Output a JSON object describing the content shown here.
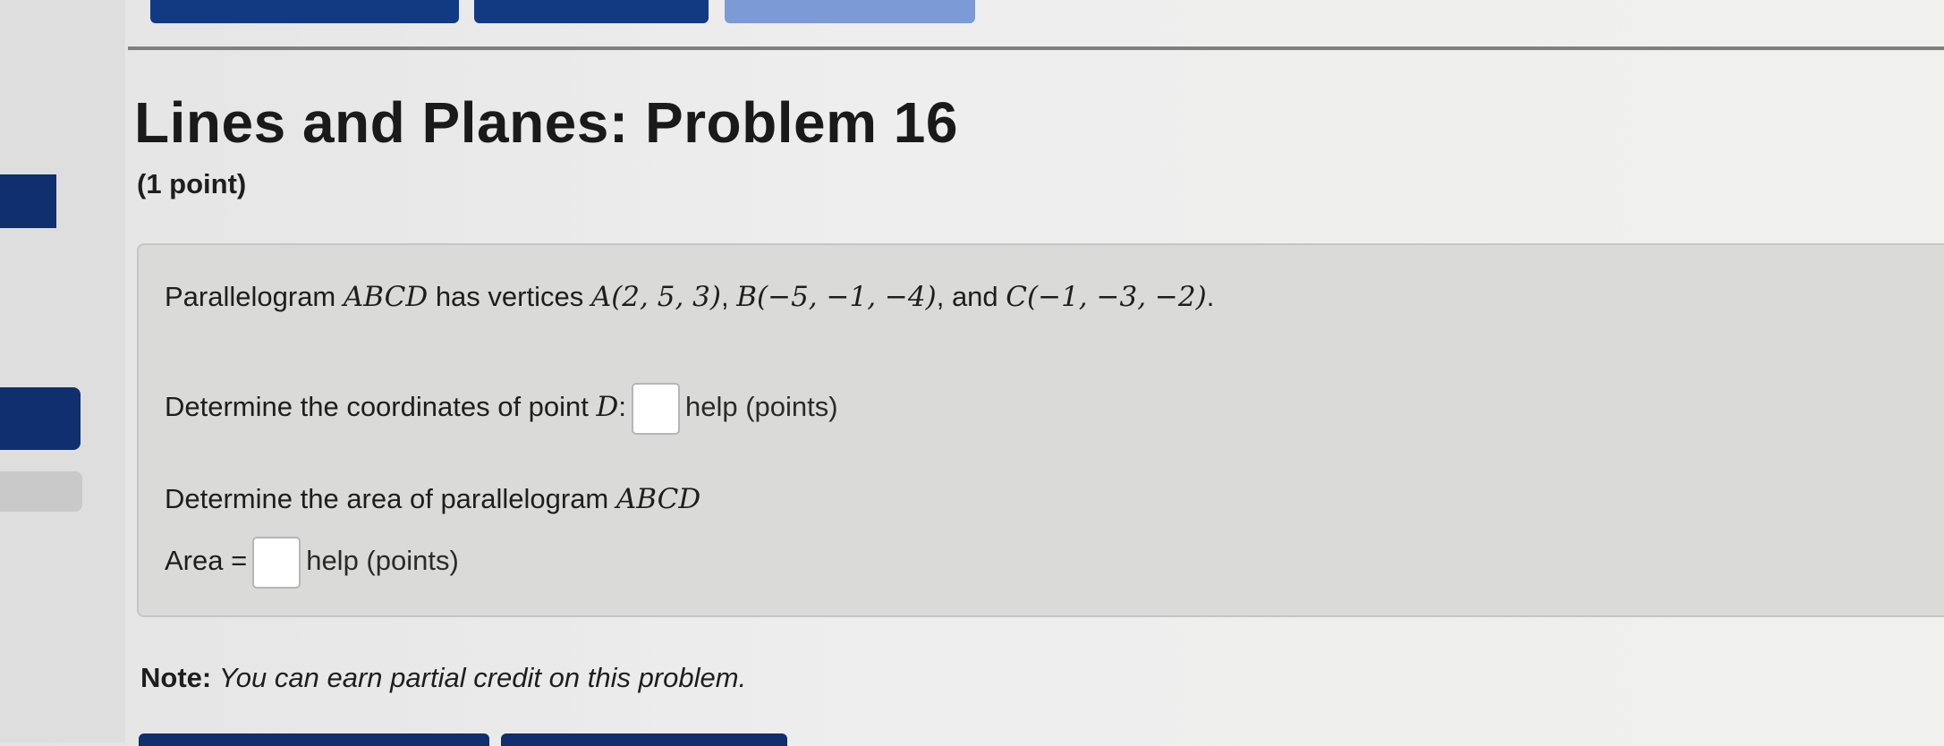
{
  "problem": {
    "title": "Lines and Planes: Problem 16",
    "points": "(1 point)",
    "statement": {
      "prefix": "Parallelogram ",
      "shape": "ABCD",
      "mid": " has vertices ",
      "vertex_a": "A(2, 5, 3)",
      "sep1": ", ",
      "vertex_b": "B(−5, −1, −4)",
      "sep2": ", and ",
      "vertex_c": "C(−1, −3, −2)",
      "end": "."
    },
    "part1": {
      "prompt": "Determine the coordinates of point ",
      "point": "D",
      "colon": ":",
      "answer_value": "",
      "help": "help (points)"
    },
    "part2": {
      "prompt": "Determine the area of parallelogram ",
      "shape": "ABCD",
      "area_label": "Area =",
      "answer_value": "",
      "help": "help (points)"
    },
    "note": {
      "label": "Note:",
      "text": "You can earn partial credit on this problem."
    }
  },
  "colors": {
    "nav_button": "#123a82",
    "nav_button_disabled": "#7c9bd6",
    "problem_box": "#dadad9"
  }
}
